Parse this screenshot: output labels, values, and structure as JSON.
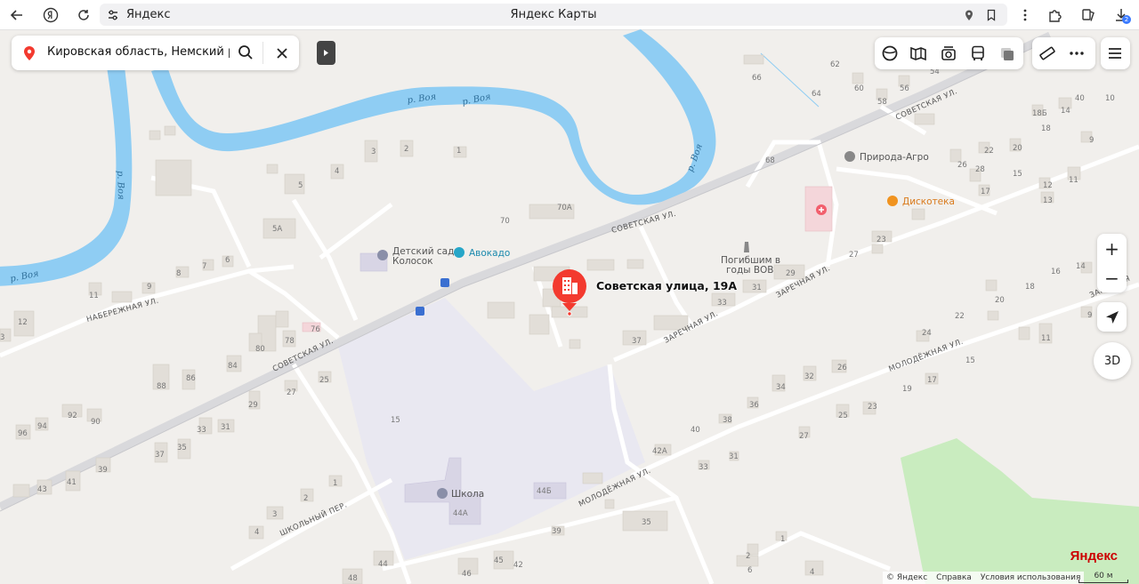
{
  "browser": {
    "site": "Яндекс",
    "title": "Яндекс Карты",
    "downloads_badge": "2"
  },
  "search": {
    "value": "Кировская область, Немский район,"
  },
  "toolbar": {
    "icons": [
      "layers-icon",
      "panorama-icon",
      "camera-icon",
      "transport-icon",
      "traffic-icon",
      "ruler-icon",
      "more-icon",
      "menu-icon"
    ]
  },
  "zoom": {
    "in": "+",
    "out": "−"
  },
  "view_3d": "3D",
  "place": {
    "title": "Советская улица, 19А",
    "marker_color": "#f33a2f"
  },
  "rivers": [
    "р. Воя",
    "р. Воя",
    "р. Воя",
    "р. Воя",
    "р. Воя"
  ],
  "streets": {
    "sovetskaya_1": "СОВЕТСКАЯ УЛ.",
    "sovetskaya_2": "СОВЕТСКАЯ УЛ.",
    "sovetskaya_3": "СОВЕТСКАЯ УЛ.",
    "naberezhnaya": "НАБЕРЕЖНАЯ УЛ.",
    "zarechnaya_1": "ЗАРЕЧНАЯ УЛ.",
    "zarechnaya_2": "ЗАРЕЧНАЯ УЛ.",
    "molodezhnaya_1": "МОЛОДЁЖНАЯ УЛ.",
    "molodezhnaya_2": "МОЛОДЁЖНАЯ УЛ.",
    "shkolny": "ШКОЛЬНЫЙ ПЕР.",
    "zarechnaya_edge": "ЗАРЕЧНАЯ"
  },
  "pois": {
    "kindergarten": "Детский сад\nКолосок",
    "kindergarten_l1": "Детский сад",
    "kindergarten_l2": "Колосок",
    "avocado": "Авокадо",
    "memorial_l1": "Погибшим в",
    "memorial_l2": "годы ВОВ",
    "priroda": "Природа-Агро",
    "disco": "Дискотека",
    "school": "Школа"
  },
  "house_numbers": [
    "62",
    "66",
    "60",
    "56",
    "54",
    "58",
    "10",
    "18Б",
    "14",
    "18",
    "9",
    "20",
    "22",
    "26",
    "28",
    "15",
    "17",
    "12",
    "11",
    "13",
    "23",
    "27",
    "29",
    "31",
    "33",
    "37",
    "16",
    "14",
    "20",
    "18",
    "22",
    "9",
    "11",
    "24",
    "26",
    "32",
    "34",
    "36",
    "38",
    "40",
    "42А",
    "33",
    "31",
    "25",
    "23",
    "27",
    "17",
    "19",
    "15",
    "70",
    "70А",
    "68",
    "64",
    "1",
    "2",
    "3",
    "4",
    "5",
    "5А",
    "8",
    "7",
    "6",
    "9",
    "11",
    "12",
    "3",
    "76",
    "78",
    "80",
    "84",
    "86",
    "88",
    "92",
    "90",
    "96",
    "94",
    "33",
    "31",
    "35",
    "37",
    "39",
    "41",
    "43",
    "29",
    "27",
    "25",
    "15",
    "1",
    "2",
    "3",
    "4",
    "44",
    "45",
    "44А",
    "44Б",
    "46",
    "48",
    "35",
    "39",
    "42",
    "1",
    "2",
    "4",
    "6",
    "40",
    "10"
  ],
  "copyright": {
    "c": "© Яндекс",
    "help": "Справка",
    "terms": "Условия использования"
  },
  "scale": "60 м",
  "brand": "Яндекс",
  "colors": {
    "land": "#f1efec",
    "water": "#8fcdf3",
    "road": "#ffffff",
    "road_major": "#d9d9dc",
    "building": "#e2ded8",
    "school_area": "#e9e8f1",
    "forest": "#c9ecbf",
    "accent_red": "#f33a2f"
  }
}
